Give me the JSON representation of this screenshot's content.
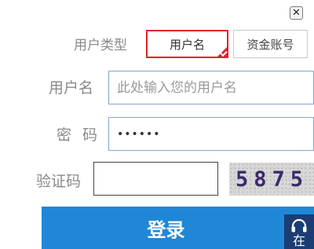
{
  "close": {
    "icon": "close-icon",
    "glyph": "✕"
  },
  "account_type": {
    "label": "用户类型",
    "tabs": [
      {
        "label": "用户名",
        "selected": true
      },
      {
        "label": "资金账号",
        "selected": false
      }
    ],
    "selected_color": "#e2232a"
  },
  "username": {
    "label": "用户名",
    "placeholder": "此处输入您的用户名",
    "value": ""
  },
  "password": {
    "label": "密码",
    "value": "••••••"
  },
  "captcha": {
    "label": "验证码",
    "value": "",
    "image_text": "5875"
  },
  "login": {
    "label": "登录",
    "color": "#1f87d6"
  },
  "service": {
    "icon": "headset-icon",
    "label": "在"
  }
}
